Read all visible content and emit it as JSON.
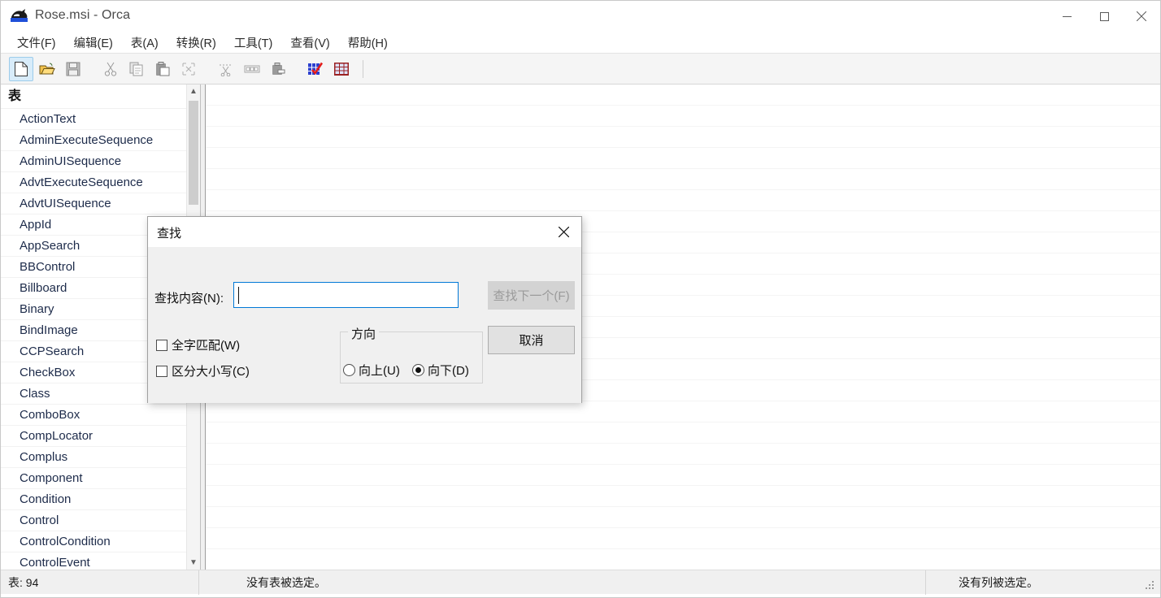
{
  "window": {
    "title": "Rose.msi - Orca",
    "icon": "orca-whale-icon",
    "minimize_label": "—",
    "maximize_label": "☐",
    "close_label": "✕"
  },
  "menubar": {
    "items": [
      {
        "label": "文件(F)",
        "name": "menu-file"
      },
      {
        "label": "编辑(E)",
        "name": "menu-edit"
      },
      {
        "label": "表(A)",
        "name": "menu-table"
      },
      {
        "label": "转换(R)",
        "name": "menu-transform"
      },
      {
        "label": "工具(T)",
        "name": "menu-tools"
      },
      {
        "label": "查看(V)",
        "name": "menu-view"
      },
      {
        "label": "帮助(H)",
        "name": "menu-help"
      }
    ]
  },
  "toolbar": {
    "buttons": [
      {
        "icon": "new-file-icon",
        "active": true
      },
      {
        "icon": "open-folder-icon",
        "active": false
      },
      {
        "icon": "save-disk-icon",
        "active": false
      },
      {
        "icon": "cut-scissors-icon",
        "active": false
      },
      {
        "icon": "copy-icon",
        "active": false
      },
      {
        "icon": "paste-icon",
        "active": false
      },
      {
        "icon": "paste-special-icon",
        "active": false
      },
      {
        "icon": "cut-row-icon",
        "active": false
      },
      {
        "icon": "drop-row-icon",
        "active": false
      },
      {
        "icon": "add-row-icon",
        "active": false
      },
      {
        "icon": "validate-table-icon",
        "active": false
      },
      {
        "icon": "table-grid-icon",
        "active": false
      }
    ]
  },
  "sidebar": {
    "header": "表",
    "items": [
      "ActionText",
      "AdminExecuteSequence",
      "AdminUISequence",
      "AdvtExecuteSequence",
      "AdvtUISequence",
      "AppId",
      "AppSearch",
      "BBControl",
      "Billboard",
      "Binary",
      "BindImage",
      "CCPSearch",
      "CheckBox",
      "Class",
      "ComboBox",
      "CompLocator",
      "Complus",
      "Component",
      "Condition",
      "Control",
      "ControlCondition",
      "ControlEvent"
    ],
    "scroll_up_icon": "chevron-up-icon",
    "scroll_down_icon": "chevron-down-icon"
  },
  "statusbar": {
    "tables_count": "表: 94",
    "table_selection": "没有表被选定。",
    "column_selection": "没有列被选定。"
  },
  "find_dialog": {
    "title": "查找",
    "close_label": "✕",
    "find_what_label": "查找内容(N):",
    "find_what_value": "",
    "find_what_placeholder": "",
    "match_whole_word": {
      "label": "全字匹配(W)",
      "checked": false
    },
    "match_case": {
      "label": "区分大小写(C)",
      "checked": false
    },
    "direction": {
      "legend": "方向",
      "up": {
        "label": "向上(U)",
        "selected": false
      },
      "down": {
        "label": "向下(D)",
        "selected": true
      }
    },
    "find_next_button": {
      "label": "查找下一个(F)",
      "disabled": true
    },
    "cancel_button": {
      "label": "取消",
      "disabled": false
    }
  },
  "background_strip": {
    "fragments": [
      " ",
      " ",
      " ",
      " ",
      " ",
      " ",
      " ",
      " ",
      " ",
      " "
    ]
  }
}
